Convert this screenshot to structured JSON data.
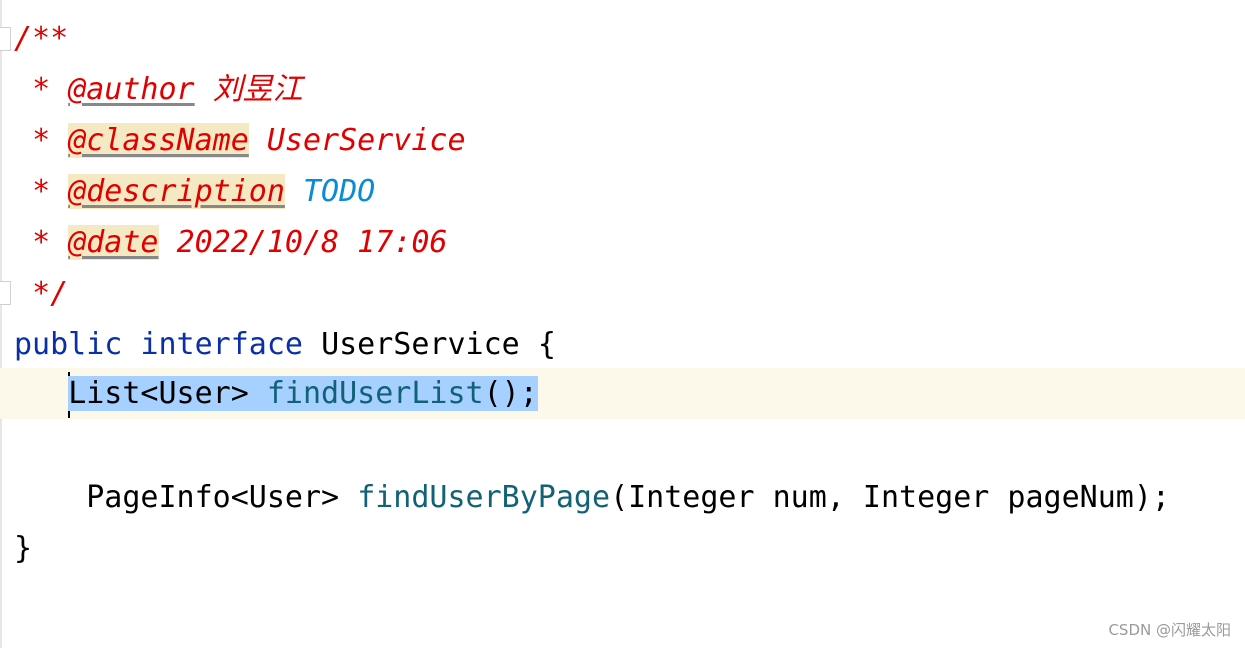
{
  "editor": {
    "doc_comment": {
      "open": "/**",
      "author_tag": "@author",
      "author_value": "刘昱江",
      "classname_tag": "@className",
      "classname_value": "UserService",
      "description_tag": "@description",
      "description_value": "TODO",
      "date_tag": "@date",
      "date_value": "2022/10/8 17:06",
      "star": "*",
      "close": "*/"
    },
    "decl": {
      "kw_public": "public",
      "kw_interface": "interface",
      "name": "UserService",
      "open_brace": "{",
      "close_brace": "}"
    },
    "method1": {
      "return_type": "List<User>",
      "name": "findUserList",
      "params": "();"
    },
    "method2": {
      "return_type": "PageInfo<User>",
      "name": "findUserByPage",
      "params": "(Integer num, Integer pageNum);"
    }
  },
  "watermark": "CSDN @闪耀太阳",
  "colors": {
    "comment": "#e00000",
    "keyword": "#0b2fa6",
    "method": "#116177",
    "todo": "#0a8ad8",
    "selection": "#a6d0ff",
    "current_line": "#fcf8ea"
  }
}
